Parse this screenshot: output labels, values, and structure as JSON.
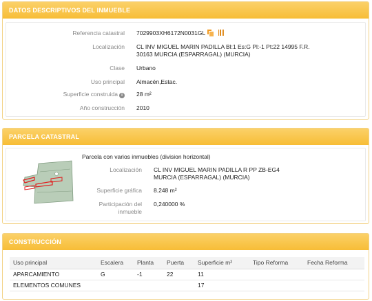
{
  "sections": {
    "descriptive": {
      "title": "DATOS DESCRIPTIVOS DEL INMUEBLE"
    },
    "parcel": {
      "title": "PARCELA CATASTRAL"
    },
    "construction": {
      "title": "CONSTRUCCIÓN"
    }
  },
  "descriptive": {
    "ref_label": "Referencia catastral",
    "ref_value": "7029903XH6172N0031GL",
    "copy_icon": "copy-icon",
    "barcode_icon": "barcode-icon",
    "loc_label": "Localización",
    "loc_line1": "CL INV MIGUEL MARIN PADILLA Bl:1 Es:G Pl:-1 Pt:22 14995 F.R.",
    "loc_line2": "30163 MURCIA (ESPARRAGAL) (MURCIA)",
    "class_label": "Clase",
    "class_value": "Urbano",
    "use_label": "Uso principal",
    "use_value": "Almacén,Estac.",
    "built_label": "Superficie construida",
    "info_icon": "info-icon",
    "built_value": "28 m²",
    "year_label": "Año construcción",
    "year_value": "2010"
  },
  "parcel": {
    "subtitle": "Parcela con varios inmuebles (division horizontal)",
    "loc_label": "Localización",
    "loc_line1": "CL INV MIGUEL MARIN PADILLA R PP ZB-EG4",
    "loc_line2": "MURCIA (ESPARRAGAL) (MURCIA)",
    "area_label": "Superficie gráfica",
    "area_value": "8.248 m²",
    "share_label_1": "Participación del",
    "share_label_2": "inmueble",
    "share_value": "0,240000 %"
  },
  "construction": {
    "headers": [
      "Uso principal",
      "Escalera",
      "Planta",
      "Puerta",
      "Superficie m²",
      "Tipo Reforma",
      "Fecha Reforma"
    ],
    "rows": [
      [
        "APARCAMIENTO",
        "G",
        "-1",
        "22",
        "11",
        "",
        ""
      ],
      [
        "ELEMENTOS COMUNES",
        "",
        "",
        "",
        "17",
        "",
        ""
      ]
    ]
  },
  "colors": {
    "header_yellow": "#f9c64a",
    "parcel_green": "#b7ccb7",
    "parcel_highlight": "#e02020"
  }
}
